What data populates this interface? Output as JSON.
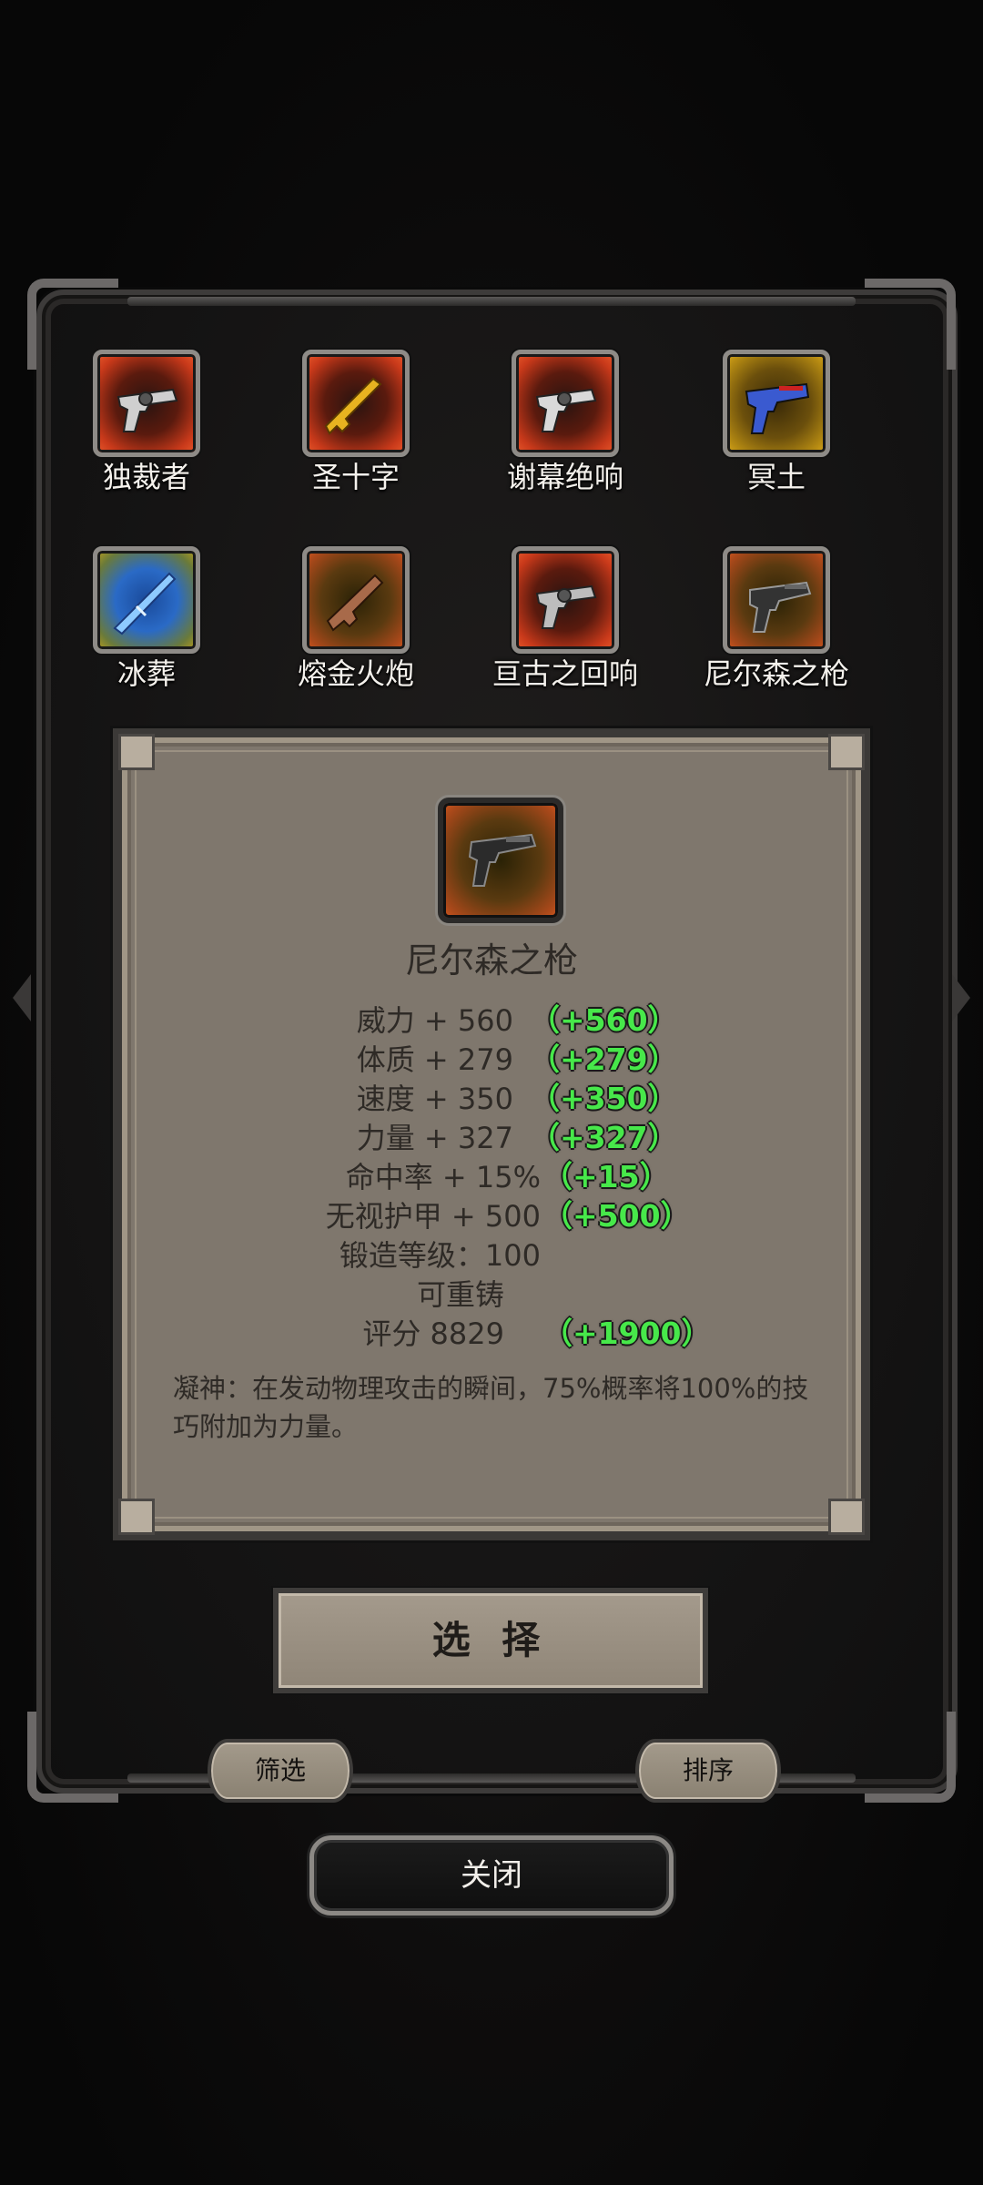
{
  "weapons": [
    {
      "name": "独裁者",
      "frame": "red",
      "icon": "revolver-icon",
      "color": "#cfcfcf"
    },
    {
      "name": "圣十字",
      "frame": "red",
      "icon": "golden-rifle-icon",
      "color": "#e8b320"
    },
    {
      "name": "谢幕绝响",
      "frame": "red",
      "icon": "revolver-icon",
      "color": "#d9d9d9"
    },
    {
      "name": "冥土",
      "frame": "gold",
      "icon": "blue-pistol-icon",
      "color": "#3a5ad0"
    },
    {
      "name": "冰葬",
      "frame": "blue-gold",
      "icon": "ice-rifle-icon",
      "color": "#8ecbff"
    },
    {
      "name": "熔金火炮",
      "frame": "gold-red",
      "icon": "shotgun-icon",
      "color": "#a86a4a"
    },
    {
      "name": "亘古之回响",
      "frame": "red",
      "icon": "revolver-icon",
      "color": "#bdbdbd"
    },
    {
      "name": "尼尔森之枪",
      "frame": "gold-red",
      "icon": "pistol-icon",
      "color": "#333333"
    }
  ],
  "detail": {
    "title": "尼尔森之枪",
    "icon": "pistol-icon",
    "stats": [
      {
        "text": "威力 + 560",
        "bonus": "（+560）"
      },
      {
        "text": "体质 + 279",
        "bonus": "（+279）"
      },
      {
        "text": "速度 + 350",
        "bonus": "（+350）"
      },
      {
        "text": "力量 + 327",
        "bonus": "（+327）"
      },
      {
        "text": "命中率 + 15%",
        "bonus": "（+15）"
      },
      {
        "text": "无视护甲 + 500",
        "bonus": "（+500）"
      },
      {
        "text": "锻造等级：100",
        "bonus": ""
      },
      {
        "text": "可重铸",
        "bonus": ""
      },
      {
        "text": "评分 8829",
        "bonus": "（+1900）"
      }
    ],
    "skill": "凝神：在发动物理攻击的瞬间，75%概率将100%的技巧附加为力量。"
  },
  "buttons": {
    "select": "选 择",
    "filter": "筛选",
    "sort": "排序",
    "close": "关闭"
  },
  "colors": {
    "bonus": "#47e84a",
    "panel": "#7f776d",
    "text_dark": "#2e2a26"
  }
}
